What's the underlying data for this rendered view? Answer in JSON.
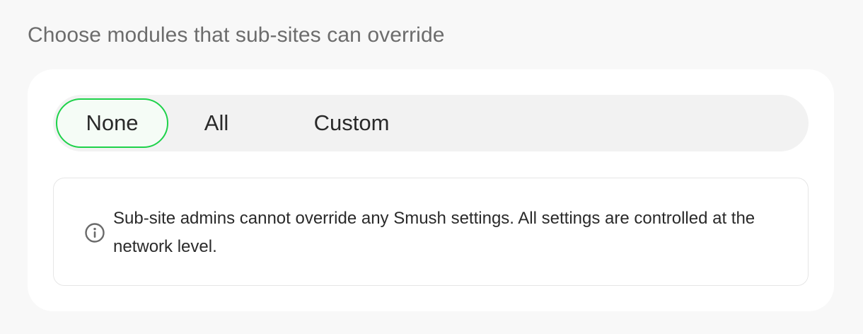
{
  "heading": "Choose modules that sub-sites can override",
  "segmented": {
    "options": [
      {
        "label": "None",
        "selected": true
      },
      {
        "label": "All",
        "selected": false
      },
      {
        "label": "Custom",
        "selected": false
      }
    ]
  },
  "notice": {
    "icon": "info-circle-icon",
    "text": "Sub-site admins cannot override any Smush settings. All settings are controlled at the network level."
  },
  "colors": {
    "background": "#f8f8f8",
    "card": "#ffffff",
    "segment_track": "#f2f2f2",
    "selected_border": "#1ed24a",
    "selected_fill": "#f5fcf6",
    "heading_text": "#6c6c6c",
    "body_text": "#2a2a2a"
  }
}
